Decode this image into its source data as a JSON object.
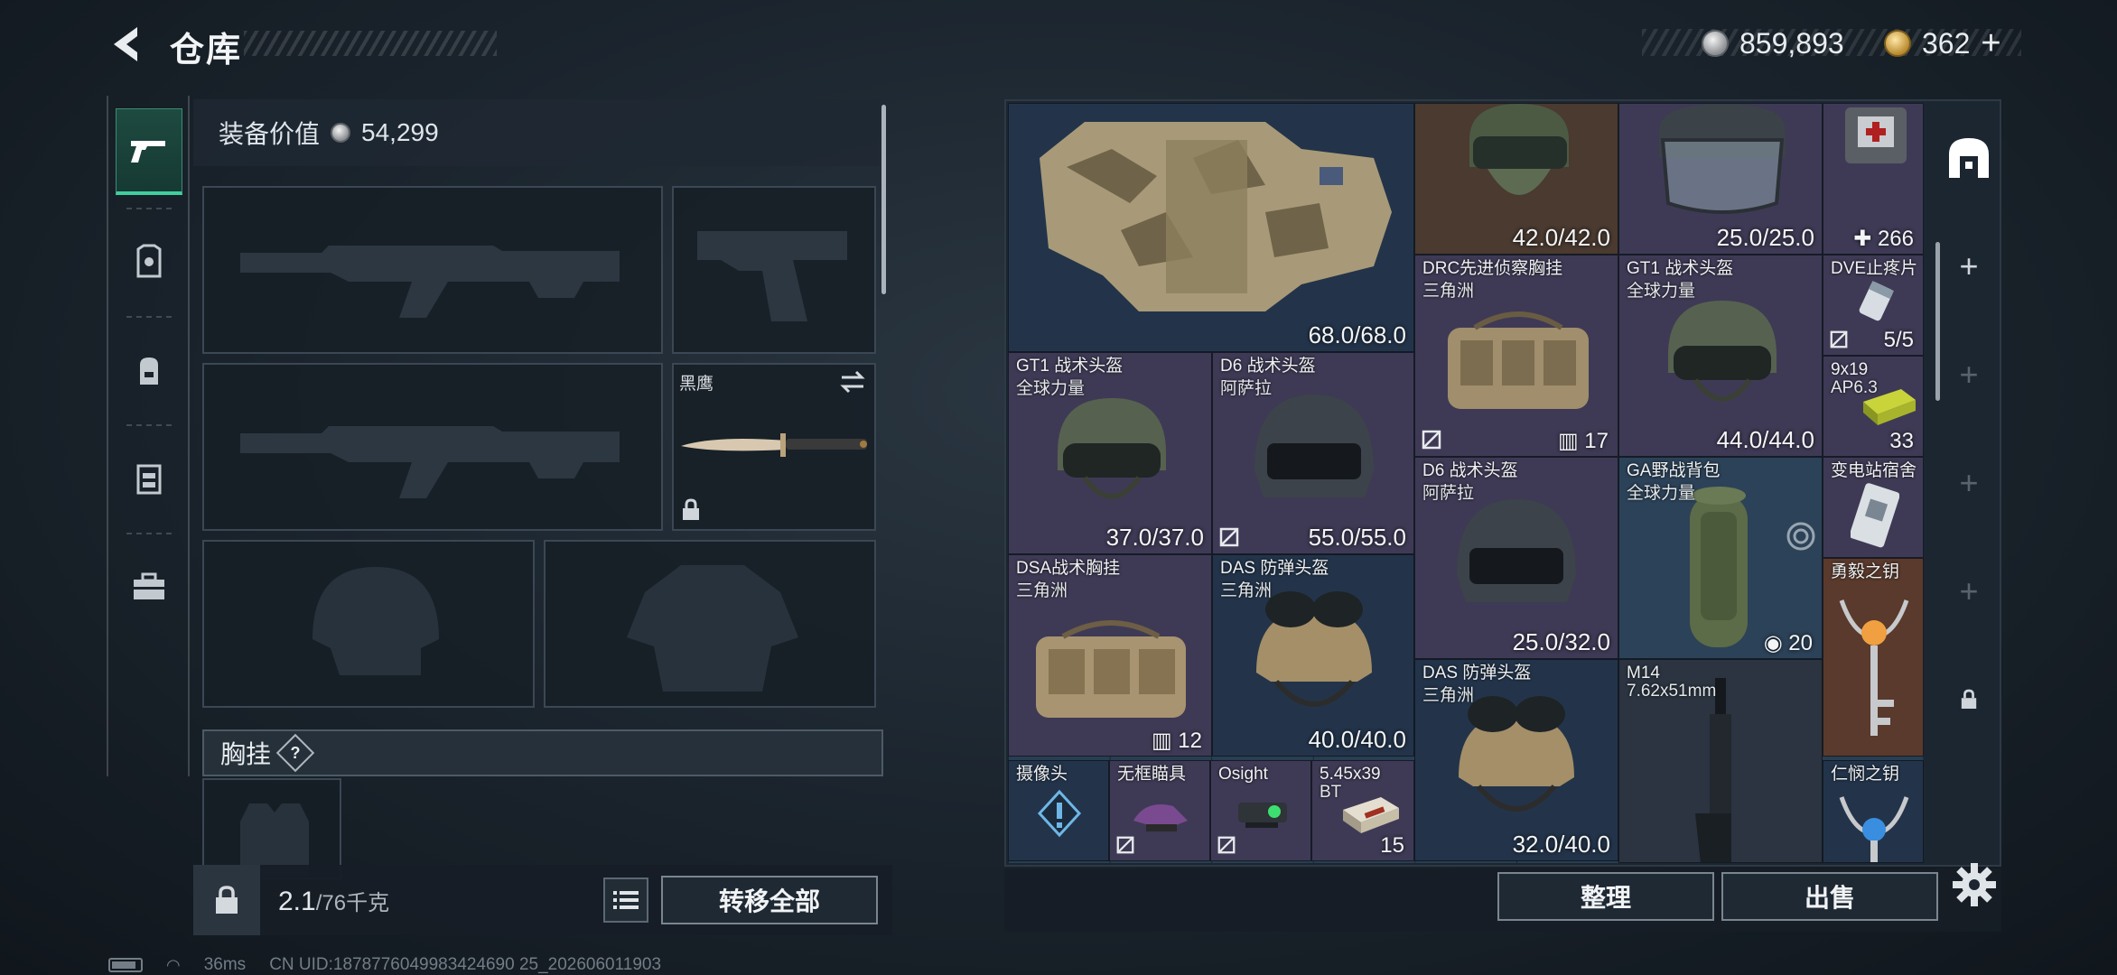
{
  "header": {
    "title": "仓库",
    "currency_silver": "859,893",
    "currency_gold": "362",
    "add_label": "+"
  },
  "equipment": {
    "value_label": "装备价值",
    "value": "54,299",
    "melee_name": "黑鹰",
    "vest_header": "胸挂",
    "help": "?",
    "weight_value": "2.1",
    "weight_max": "/76千克",
    "transfer_all": "转移全部"
  },
  "inventory": {
    "items": [
      {
        "name": "",
        "sub": "",
        "dur": "68.0/68.0"
      },
      {
        "name": "",
        "sub": "",
        "dur": "42.0/42.0"
      },
      {
        "name": "",
        "sub": "",
        "dur": "25.0/25.0"
      },
      {
        "name": "",
        "sub": "",
        "cnt": "266"
      },
      {
        "name": "DRC先进侦察胸挂",
        "sub": "三角洲",
        "cnt": "17"
      },
      {
        "name": "GT1 战术头盔",
        "sub": "全球力量",
        "dur": "44.0/44.0"
      },
      {
        "name": "DVE止疼片",
        "sub": "",
        "cnt": "5/5"
      },
      {
        "name": "GT1 战术头盔",
        "sub": "全球力量",
        "dur": "37.0/37.0"
      },
      {
        "name": "D6 战术头盔",
        "sub": "阿萨拉",
        "dur": "55.0/55.0"
      },
      {
        "name": "9x19",
        "sub": "AP6.3",
        "cnt": "33"
      },
      {
        "name": "D6 战术头盔",
        "sub": "阿萨拉",
        "dur": "25.0/32.0"
      },
      {
        "name": "GA野战背包",
        "sub": "全球力量",
        "cnt": "20"
      },
      {
        "name": "变电站宿舍",
        "sub": ""
      },
      {
        "name": "DSA战术胸挂",
        "sub": "三角洲",
        "cnt": "12"
      },
      {
        "name": "DAS 防弹头盔",
        "sub": "三角洲",
        "dur": "40.0/40.0"
      },
      {
        "name": "勇毅之钥",
        "sub": ""
      },
      {
        "name": "DAS 防弹头盔",
        "sub": "三角洲",
        "dur": "32.0/40.0"
      },
      {
        "name": "M14",
        "sub": "7.62x51mm"
      },
      {
        "name": "摄像头",
        "sub": ""
      },
      {
        "name": "无框瞄具",
        "sub": ""
      },
      {
        "name": "Osight",
        "sub": ""
      },
      {
        "name": "5.45x39",
        "sub": "BT",
        "cnt": "15"
      },
      {
        "name": "仁悯之钥",
        "sub": ""
      }
    ]
  },
  "actions": {
    "sort": "整理",
    "sell": "出售"
  },
  "status": {
    "ping": "36ms",
    "uid": "CN UID:1878776049983424690 25_202606011903"
  },
  "colors": {
    "accent_green": "#3fcf9f",
    "panel_dark": "#1c2631"
  }
}
